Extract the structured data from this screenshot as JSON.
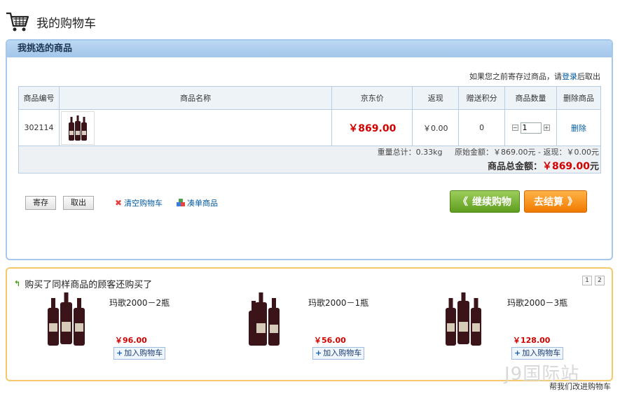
{
  "header": {
    "title": "我的购物车",
    "icon": "cart-icon"
  },
  "cart": {
    "panel_title": "我挑选的商品",
    "login_hint": {
      "before": "如果您之前寄存过商品，请",
      "link": "登录",
      "after": "后取出"
    },
    "columns": [
      "商品编号",
      "商品名称",
      "京东价",
      "返现",
      "赠送积分",
      "商品数量",
      "删除商品"
    ],
    "row": {
      "id": "302114",
      "price": "￥869.00",
      "cashback": "￥0.00",
      "points": "0",
      "qty": "1",
      "delete": "删除"
    },
    "summary": {
      "weight": "重量总计：0.33kg",
      "original": "原始金额：￥869.00元",
      "minus": "-",
      "return": "返现：￥0.00元",
      "total_label": "商品总金额：",
      "total_value": "￥869.00",
      "total_unit": "元"
    },
    "buttons": {
      "store": "寄存",
      "retrieve": "取出",
      "clear": "清空购物车",
      "addon": "凑单商品",
      "continue": "继续购物",
      "checkout": "去结算"
    }
  },
  "recommend": {
    "title": "购买了同样商品的顾客还购买了",
    "pager": [
      "1",
      "2"
    ],
    "items": [
      {
        "name": "玛歌2000－2瓶",
        "price": "￥96.00",
        "add": "加入购物车"
      },
      {
        "name": "玛歌2000－1瓶",
        "price": "￥56.00",
        "add": "加入购物车"
      },
      {
        "name": "玛歌2000－3瓶",
        "price": "￥128.00",
        "add": "加入购物车"
      }
    ]
  },
  "watermark": "J9国际站",
  "help_link": "帮我们改进购物车",
  "colors": {
    "price_red": "#d30000",
    "panel_blue": "#a6c8ea",
    "panel_gold": "#f5c86a",
    "btn_green": "#5f9e1e",
    "btn_orange": "#f07a00"
  }
}
